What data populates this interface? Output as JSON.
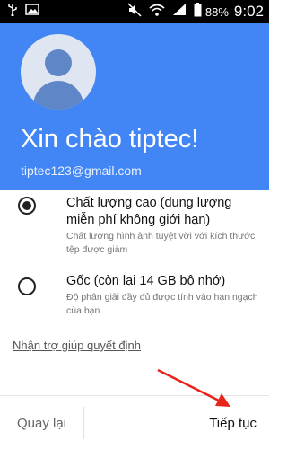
{
  "status_bar": {
    "battery_percent": "88%",
    "time": "9:02",
    "left_icons": [
      "usb-icon",
      "image-icon"
    ],
    "right_icons": [
      "mute-icon",
      "wifi-icon",
      "signal-icon",
      "battery-icon"
    ]
  },
  "header": {
    "greeting": "Xin chào tiptec!",
    "email": "tiptec123@gmail.com",
    "background_color": "#4285f4"
  },
  "options": [
    {
      "title": "Chất lượng cao (dung lượng miễn phí không giới hạn)",
      "description": "Chất lượng hình ảnh tuyệt vời với kích thước tệp được giảm",
      "selected": true
    },
    {
      "title": "Gốc (còn lại 14 GB bộ nhớ)",
      "description": "Độ phân giải đầy đủ được tính vào hạn ngạch của bạn",
      "selected": false
    }
  ],
  "help_link": "Nhận trợ giúp quyết định",
  "buttons": {
    "back": "Quay lại",
    "continue": "Tiếp tục"
  },
  "annotation": {
    "arrow_color": "#e8231a"
  }
}
